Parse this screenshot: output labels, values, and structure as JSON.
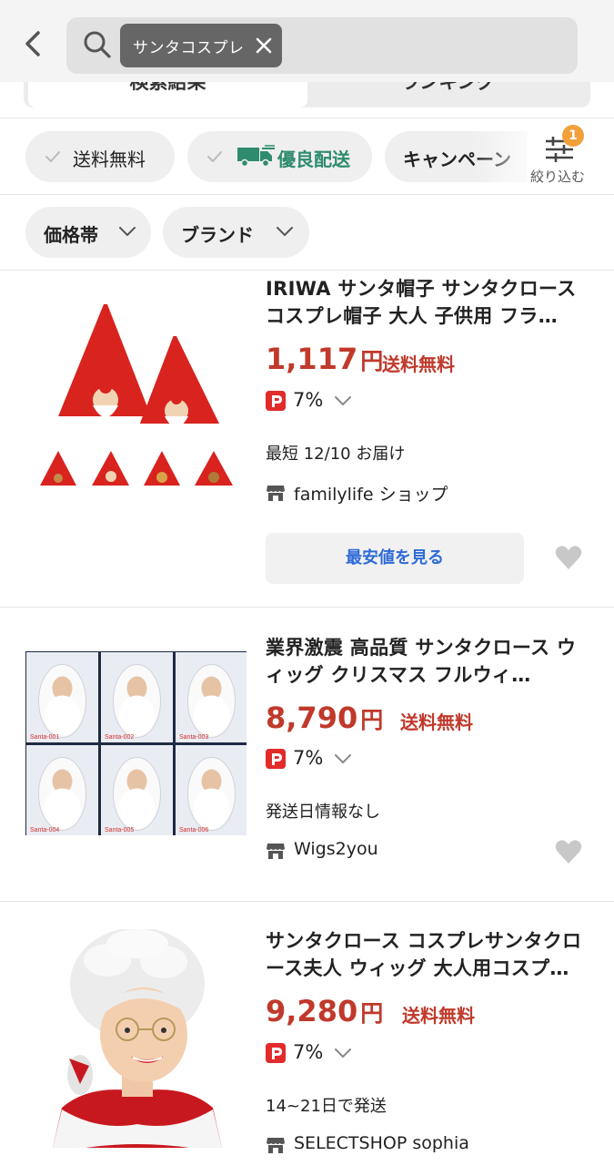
{
  "search": {
    "query_chip": "サンタコスプレ"
  },
  "tabs": [
    {
      "label": "検索結果"
    },
    {
      "label": "ランキング"
    }
  ],
  "quick_filters": [
    {
      "label": "送料無料"
    },
    {
      "label": "優良配送"
    },
    {
      "label": "キャンペーン"
    }
  ],
  "refine": {
    "label": "絞り込む",
    "badge": "1"
  },
  "dropdown_filters": [
    {
      "label": "価格帯"
    },
    {
      "label": "ブランド"
    }
  ],
  "products": [
    {
      "title": "IRIWA サンタ帽子 サンタクロース コスプレ帽子 大人 子供用 フラ…",
      "price": "1,117",
      "currency": "円",
      "shipping": "送料無料",
      "points": "7%",
      "delivery": "最短 12/10 お届け",
      "shop": "familylife ショップ",
      "compare_button": "最安値を見る"
    },
    {
      "title": "業界激震 高品質 サンタクロース ウィッグ クリスマス フルウィ…",
      "price": "8,790",
      "currency": "円",
      "shipping": "送料無料",
      "points": "7%",
      "delivery": "発送日情報なし",
      "shop": "Wigs2you"
    },
    {
      "title": "サンタクロース コスプレサンタクロース夫人 ウィッグ 大人用コスプ…",
      "price": "9,280",
      "currency": "円",
      "shipping": "送料無料",
      "points": "7%",
      "delivery": "14~21日で発送",
      "shop": "SELECTSHOP sophia"
    }
  ],
  "wig_labels": [
    "Santa-001",
    "Santa-002",
    "Santa-003",
    "Santa-004",
    "Santa-005",
    "Santa-006"
  ],
  "colors": {
    "price": "#c0392b",
    "link": "#2f6bd6",
    "green": "#2e8b6e",
    "badge": "#f2a03c",
    "paypay": "#e22b2b"
  }
}
